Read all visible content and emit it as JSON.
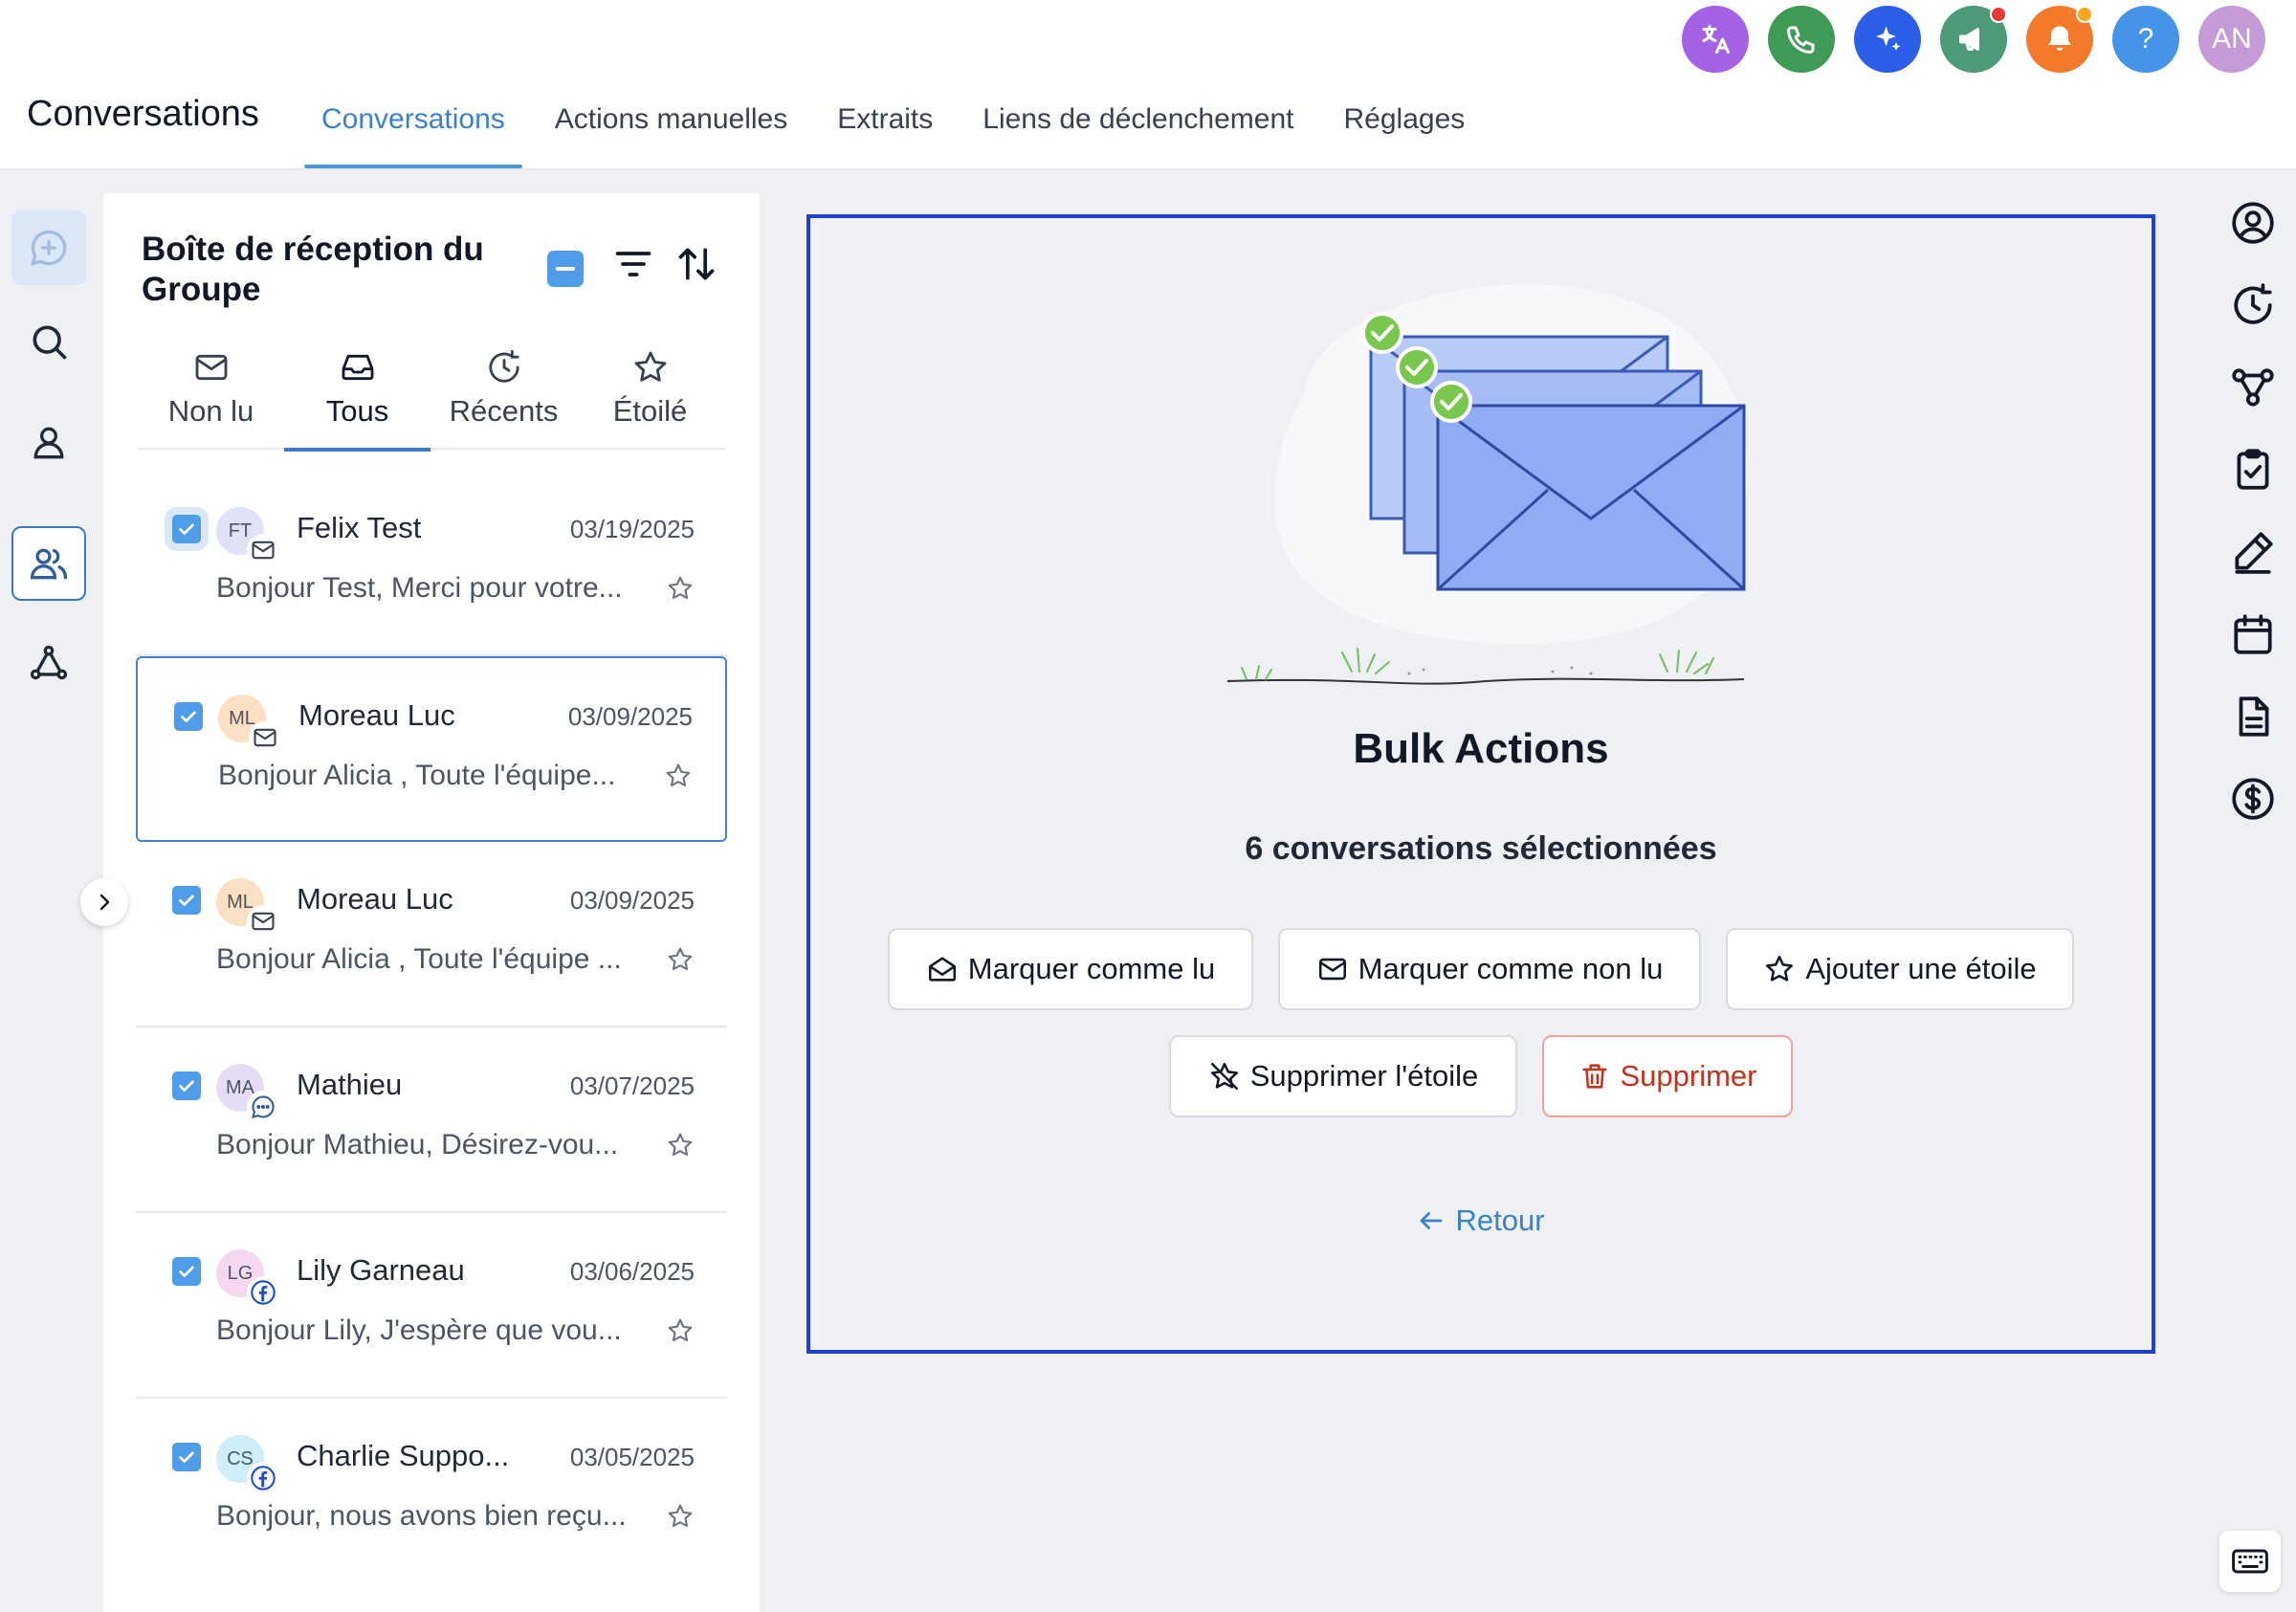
{
  "app": {
    "title": "Conversations"
  },
  "top_tabs": [
    {
      "label": "Conversations",
      "active": true
    },
    {
      "label": "Actions manuelles",
      "active": false
    },
    {
      "label": "Extraits",
      "active": false
    },
    {
      "label": "Liens de déclenchement",
      "active": false
    },
    {
      "label": "Réglages",
      "active": false
    }
  ],
  "top_icons": {
    "help_symbol": "?",
    "avatar_initials": "AN",
    "names": [
      "translate-icon",
      "phone-icon",
      "sparkle-icon",
      "megaphone-icon",
      "bell-icon",
      "help-icon",
      "user-avatar"
    ],
    "colors": {
      "purple": "#a463e6",
      "green": "#3f9a56",
      "blue": "#2c5fe8",
      "teal": "#4c9a77",
      "orange": "#f47a2b",
      "sky": "#4594ea",
      "badge_red": "#e53935",
      "badge_amber": "#f6a623"
    }
  },
  "inbox": {
    "title": "Boîte de réception du Groupe",
    "tabs": [
      {
        "label": "Non lu",
        "icon": "mail-icon"
      },
      {
        "label": "Tous",
        "icon": "inbox-icon",
        "active": true
      },
      {
        "label": "Récents",
        "icon": "clock-icon"
      },
      {
        "label": "Étoilé",
        "icon": "star-icon"
      }
    ],
    "conversations": [
      {
        "initials": "FT",
        "name": "Felix Test",
        "date": "03/19/2025",
        "preview": "Bonjour Test, Merci pour votre...",
        "channel": "email",
        "avatar_color": "#e0e3f7"
      },
      {
        "initials": "ML",
        "name": "Moreau Luc",
        "date": "03/09/2025",
        "preview": "Bonjour Alicia , Toute l'équipe...",
        "channel": "email",
        "avatar_color": "#fbe0c3"
      },
      {
        "initials": "ML",
        "name": "Moreau Luc",
        "date": "03/09/2025",
        "preview": "Bonjour Alicia , Toute l'équipe ...",
        "channel": "email",
        "avatar_color": "#fbe0c3"
      },
      {
        "initials": "MA",
        "name": "Mathieu",
        "date": "03/07/2025",
        "preview": "Bonjour Mathieu, Désirez-vou...",
        "channel": "chat",
        "avatar_color": "#e7dcf5"
      },
      {
        "initials": "LG",
        "name": "Lily Garneau",
        "date": "03/06/2025",
        "preview": "Bonjour Lily, J'espère que vou...",
        "channel": "facebook",
        "avatar_color": "#f5d8ef"
      },
      {
        "initials": "CS",
        "name": "Charlie Suppo...",
        "date": "03/05/2025",
        "preview": "Bonjour, nous avons bien reçu...",
        "channel": "facebook",
        "avatar_color": "#cdeefa"
      }
    ]
  },
  "bulk": {
    "title": "Bulk Actions",
    "count_text": "6 conversations sélectionnées",
    "actions": {
      "mark_read": "Marquer comme lu",
      "mark_unread": "Marquer comme non lu",
      "add_star": "Ajouter une étoile",
      "remove_star": "Supprimer l'étoile",
      "delete": "Supprimer"
    },
    "back": "Retour"
  },
  "colors": {
    "accent": "#3b82c4",
    "checkbox": "#4f9de8",
    "panel_border": "#1f3fd0",
    "danger": "#c2331f",
    "envelope": "#8fadf2",
    "check_green": "#7ac74f"
  }
}
